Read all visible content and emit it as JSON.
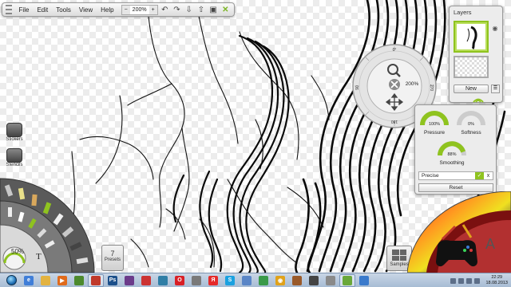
{
  "menu": {
    "items": [
      "File",
      "Edit",
      "Tools",
      "View",
      "Help"
    ],
    "zoom": "200%",
    "icons": [
      "minus-icon",
      "plus-icon",
      "undo-icon",
      "redo-icon",
      "import-icon",
      "export-icon",
      "save-icon",
      "fullscreen-icon"
    ]
  },
  "layers": {
    "title": "Layers",
    "new_label": "New"
  },
  "transform": {
    "zoom_label": "200%",
    "rotation_top": "0°",
    "rotation_left": "90",
    "rotation_right": "270",
    "rotation_bottom": "180"
  },
  "brush": {
    "pressure": {
      "value": "100%",
      "label": "Pressure"
    },
    "softness": {
      "value": "0%",
      "label": "Softness"
    },
    "smoothing": {
      "value": "88%",
      "label": "Smoothing"
    },
    "precise_label": "Precise",
    "reset_label": "Reset"
  },
  "left": {
    "stickers_label": "Stickers",
    "stencils_label": "Stencils",
    "brush_size": "50%",
    "presets_count": "7",
    "presets_label": "Presets"
  },
  "samples_label": "Samples",
  "taskbar": {
    "time": "22:29",
    "date": "18.08.2013",
    "apps": [
      {
        "icon": "explorer-icon",
        "color": "#3f7ed8",
        "glyph": "e"
      },
      {
        "icon": "folder-icon",
        "color": "#e3b341",
        "glyph": ""
      },
      {
        "icon": "media-player-icon",
        "color": "#e06a1b",
        "glyph": "▶"
      },
      {
        "icon": "app-icon",
        "color": "#4c8a2e",
        "glyph": ""
      },
      {
        "icon": "artrage-icon",
        "color": "#c0392b",
        "glyph": ""
      },
      {
        "icon": "photoshop-icon",
        "color": "#1b4f8a",
        "glyph": "Ps"
      },
      {
        "icon": "app-icon",
        "color": "#6b3b8a",
        "glyph": ""
      },
      {
        "icon": "app-icon",
        "color": "#cc3333",
        "glyph": ""
      },
      {
        "icon": "app-icon",
        "color": "#2f7ea6",
        "glyph": ""
      },
      {
        "icon": "opera-icon",
        "color": "#d81f26",
        "glyph": "O"
      },
      {
        "icon": "app-icon",
        "color": "#7a7a7a",
        "glyph": ""
      },
      {
        "icon": "yandex-icon",
        "color": "#e52a2a",
        "glyph": "Я"
      },
      {
        "icon": "skype-icon",
        "color": "#1aa1e0",
        "glyph": "S"
      },
      {
        "icon": "app-icon",
        "color": "#5a86c7",
        "glyph": ""
      },
      {
        "icon": "app-icon",
        "color": "#3a9a4a",
        "glyph": ""
      },
      {
        "icon": "chrome-icon",
        "color": "#e0a21b",
        "glyph": "◉"
      },
      {
        "icon": "app-icon",
        "color": "#9a5a2a",
        "glyph": ""
      },
      {
        "icon": "app-icon",
        "color": "#444444",
        "glyph": ""
      },
      {
        "icon": "app-icon",
        "color": "#8a8a8a",
        "glyph": ""
      },
      {
        "icon": "artrage-icon",
        "color": "#6aa83a",
        "glyph": ""
      },
      {
        "icon": "app-icon",
        "color": "#3a7acc",
        "glyph": ""
      }
    ]
  },
  "colors": {
    "accent_green": "#8fc31f",
    "panel_bg": "#ececec"
  }
}
